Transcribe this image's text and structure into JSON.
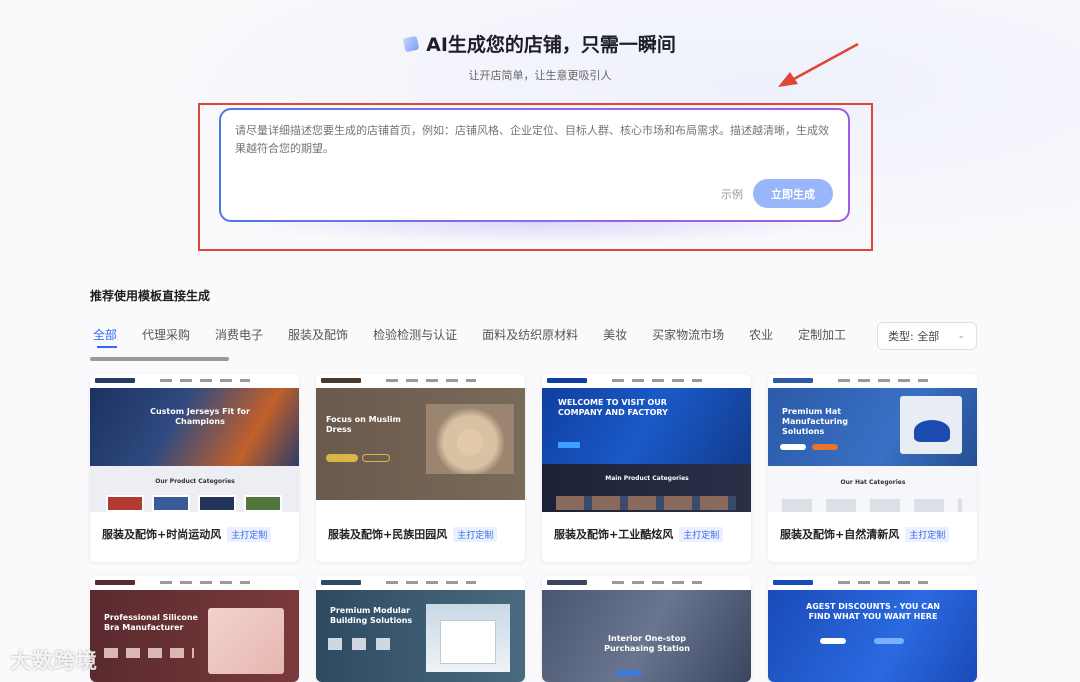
{
  "hero": {
    "title": "AI生成您的店铺，只需一瞬间",
    "subtitle": "让开店简单，让生意更吸引人"
  },
  "prompt": {
    "placeholder": "请尽量详细描述您要生成的店铺首页，例如：店铺风格、企业定位、目标人群、核心市场和布局需求。描述越清晰，生成效果越符合您的期望。",
    "example_label": "示例",
    "generate_label": "立即生成"
  },
  "templates": {
    "section_title": "推荐使用模板直接生成",
    "tabs": [
      "全部",
      "代理采购",
      "消费电子",
      "服装及配饰",
      "检验检测与认证",
      "面料及纺织原材料",
      "美妆",
      "买家物流市场",
      "农业",
      "定制加工"
    ],
    "type_select": "类型: 全部",
    "tag_label": "主打定制",
    "cards_row1": [
      {
        "title": "服装及配饰+时尚运动风",
        "hero": "Custom Jerseys Fit for Champions",
        "sub": "Our Product Categories",
        "logo": "Product Cusom"
      },
      {
        "title": "服装及配饰+民族田园风",
        "hero": "Focus on Muslim Dress",
        "logo": "ELEGANT MODEST"
      },
      {
        "title": "服装及配饰+工业酷炫风",
        "hero": "WELCOME TO VISIT OUR COMPANY AND FACTORY",
        "sub": "Main Product Categories"
      },
      {
        "title": "服装及配饰+自然清新风",
        "hero": "Premium Hat Manufacturing Solutions",
        "sub": "Our Hat Categories",
        "logo": "HatCraft Global"
      }
    ],
    "cards_row2": [
      {
        "hero": "Professional Silicone Bra Manufacturer"
      },
      {
        "hero": "Premium Modular Building Solutions"
      },
      {
        "hero": "Interior One-stop Purchasing Station"
      },
      {
        "hero": "AGEST DISCOUNTS - YOU CAN FIND WHAT YOU WANT HERE",
        "logo": "AGESTDISCOUNTS"
      }
    ]
  },
  "watermark": "大数跨境",
  "colors": {
    "accent": "#2f6bf2",
    "annotation": "#e0453a"
  }
}
